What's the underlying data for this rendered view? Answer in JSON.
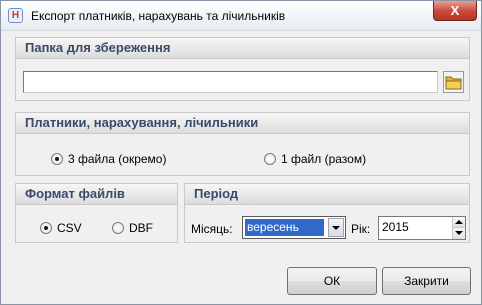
{
  "window": {
    "title": "Експорт платників, нарахувань та лічильників",
    "app_icon_glyph": "Н",
    "close_glyph": "X"
  },
  "save_folder": {
    "header": "Папка для збереження",
    "path_value": "",
    "browse_icon": "folder-icon"
  },
  "export_mode": {
    "header": "Платники, нарахування, лічильники",
    "options": [
      {
        "label": "3 файла (окремо)",
        "checked": true
      },
      {
        "label": "1 файл (разом)",
        "checked": false
      }
    ]
  },
  "file_format": {
    "header": "Формат файлів",
    "options": [
      {
        "label": "CSV",
        "checked": true
      },
      {
        "label": "DBF",
        "checked": false
      }
    ]
  },
  "period": {
    "header": "Період",
    "month_label": "Місяць:",
    "month_value": "вересень",
    "year_label": "Рік:",
    "year_value": "2015"
  },
  "buttons": {
    "ok": "ОК",
    "close": "Закрити"
  },
  "colors": {
    "group_header_text": "#3a4a6a",
    "selection": "#3169c6",
    "close_button": "#c9483a"
  }
}
